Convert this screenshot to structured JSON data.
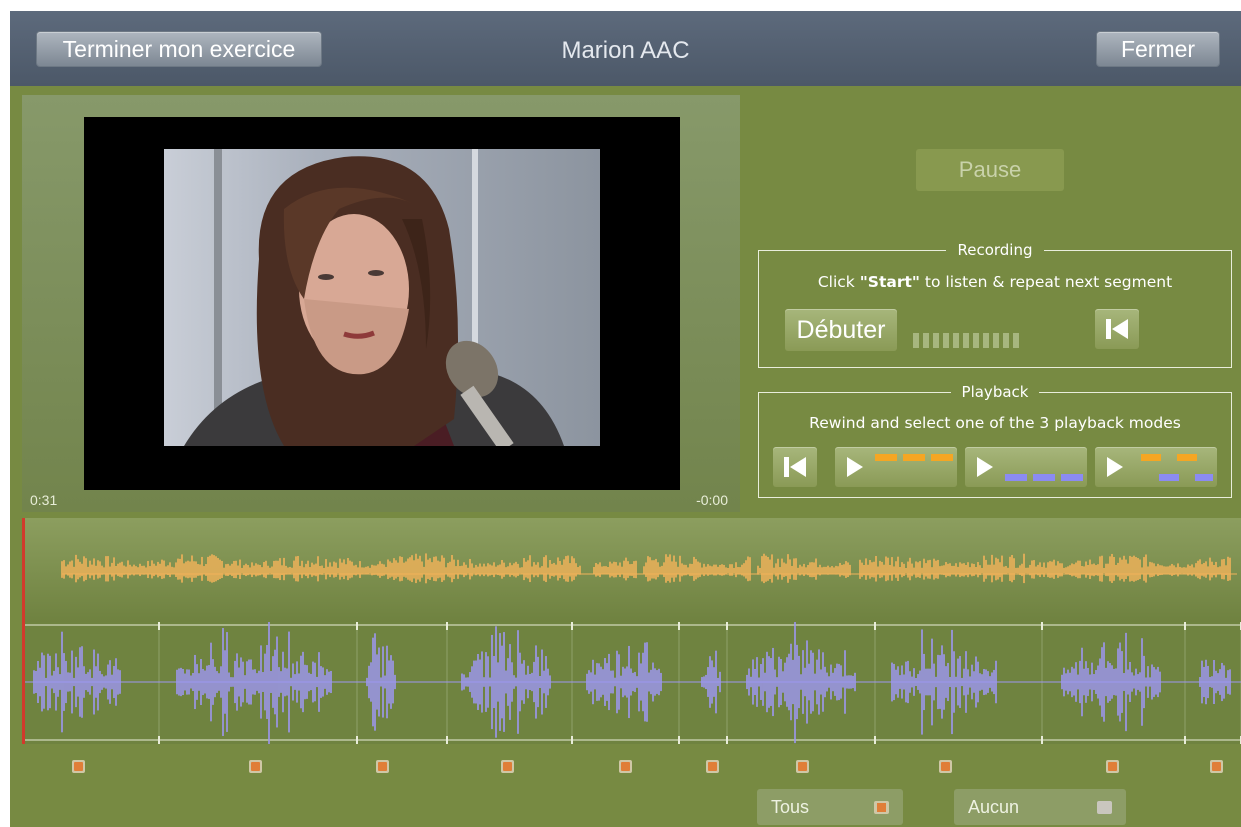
{
  "header": {
    "finish_label": "Terminer mon exercice",
    "title": "Marion AAC",
    "close_label": "Fermer"
  },
  "video": {
    "time_elapsed": "0:31",
    "time_remaining": "-0:00"
  },
  "controls": {
    "pause_label": "Pause"
  },
  "recording": {
    "legend": "Recording",
    "instruction_pre": "Click ",
    "instruction_bold": "\"Start\"",
    "instruction_post": " to listen & repeat next segment",
    "start_label": "Débuter",
    "level_segments": 11,
    "rewind_icon": "skip-back-icon"
  },
  "playback": {
    "legend": "Playback",
    "instruction": "Rewind and select one of the 3 playback modes",
    "modes": [
      "play-model-icon",
      "play-recording-icon",
      "play-alternating-icon"
    ],
    "rewind_icon": "skip-back-icon"
  },
  "segments": {
    "count": 10,
    "all_checked": true
  },
  "selection": {
    "all_label": "Tous",
    "none_label": "Aucun"
  },
  "colors": {
    "background": "#778a42",
    "header": "#56626f",
    "model_wave": "#f2b35a",
    "user_wave": "#9d97f1",
    "mode_orange": "#f5a623",
    "mode_blue": "#8b8bf2",
    "playhead": "#d23a2c"
  }
}
